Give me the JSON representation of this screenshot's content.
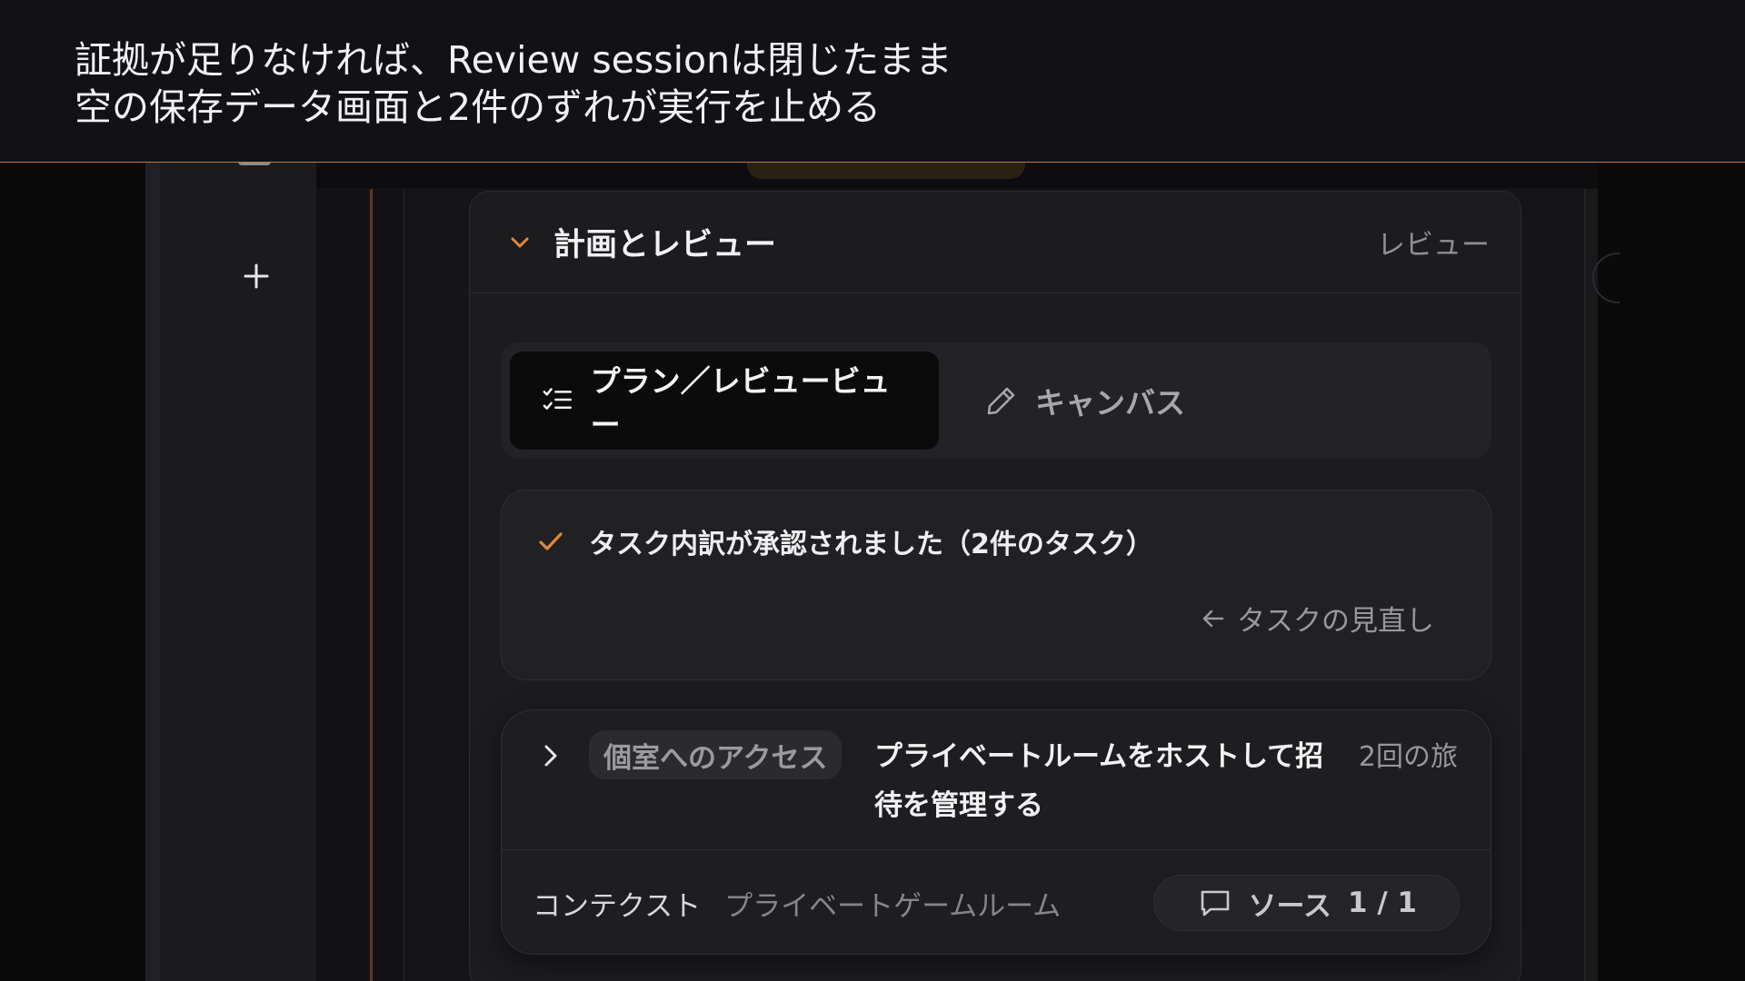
{
  "caption": {
    "line1": "証拠が足りなければ、Review sessionは閉じたまま",
    "line2": "空の保存データ画面と2件のずれが実行を止める"
  },
  "panel": {
    "title": "計画とレビュー",
    "tag": "レビュー"
  },
  "tabs": [
    {
      "label": "プラン／レビュービュー",
      "icon": "checklist-icon",
      "active": true
    },
    {
      "label": "キャンバス",
      "icon": "pencil-icon",
      "active": false
    }
  ],
  "approval": {
    "text": "タスク内訳が承認されました（2件のタスク）",
    "review_link": "タスクの見直し"
  },
  "task": {
    "badge": "個室へのアクセス",
    "title": "プライベートルームをホストして招待を管理する",
    "trips": "2回の旅",
    "context_label": "コンテクスト",
    "context_value": "プライベートゲームルーム",
    "source_label": "ソース",
    "source_count": "1 / 1"
  },
  "colors": {
    "accent": "#e0883a",
    "background": "#0a0a0b",
    "panel": "#1c1c1f"
  }
}
